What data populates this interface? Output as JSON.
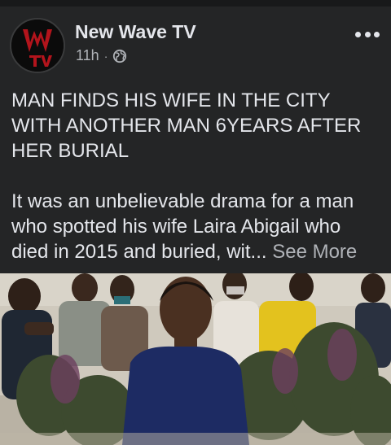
{
  "post": {
    "author": "New Wave TV",
    "time": "11h",
    "separator": "·",
    "headline_lines": [
      "MAN FINDS HIS WIFE IN THE CITY",
      "WITH ANOTHER MAN 6YEARS AFTER",
      "HER BURIAL"
    ],
    "body_lines": [
      "It was an unbelievable drama for a man",
      "who spotted his wife Laira Abigail who"
    ],
    "body_last": "died in 2015 and buried, wit...",
    "see_more": "See More"
  },
  "icons": {
    "privacy": "globe-icon",
    "menu": "more-options-icon",
    "avatar": "new-wave-tv-logo"
  },
  "colors": {
    "background": "#242526",
    "text": "#e4e6eb",
    "secondary_text": "#b0b3b8",
    "logo_red": "#b3141c"
  }
}
